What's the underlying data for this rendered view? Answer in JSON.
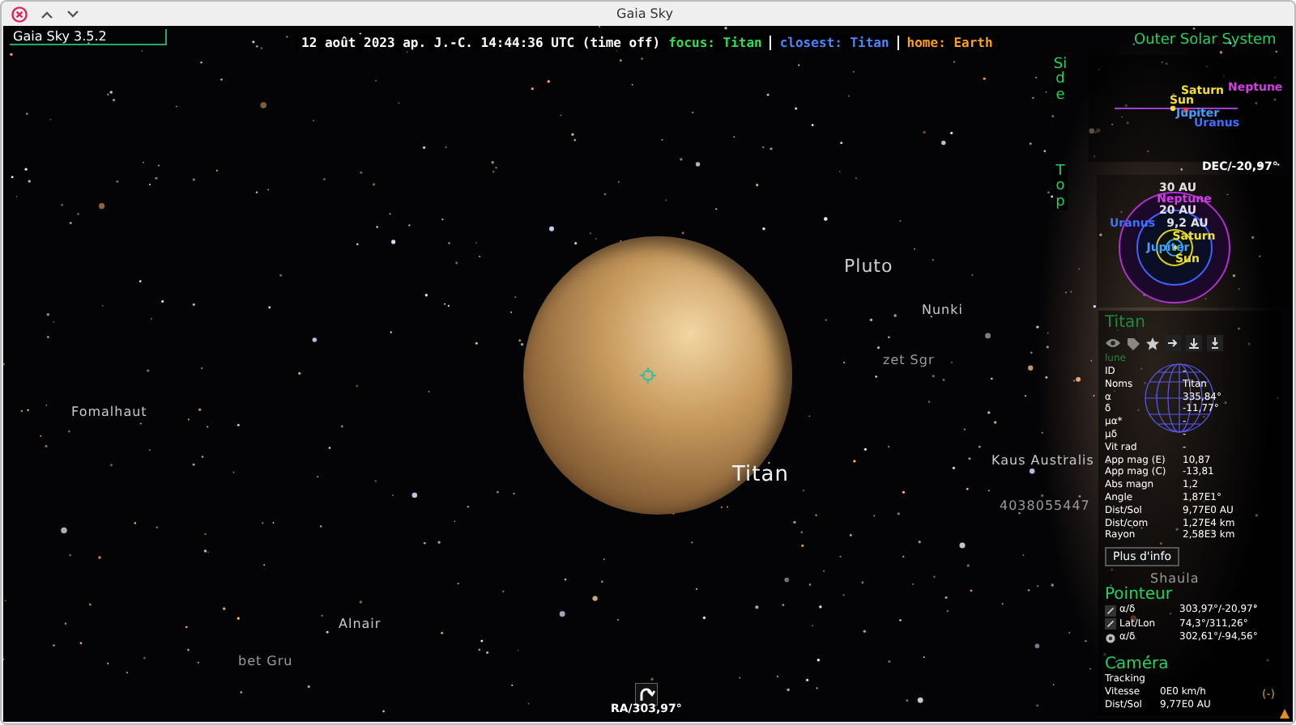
{
  "window": {
    "title": "Gaia Sky"
  },
  "app_version": "Gaia Sky 3.5.2",
  "status": [
    {
      "text": "12 août 2023 ap. J.-C. 14:44:36 UTC (time off)",
      "color": "#ffffff"
    },
    {
      "text": "focus: Titan",
      "color": "#33dd55"
    },
    {
      "text": "closest: Titan",
      "color": "#4a86ff"
    },
    {
      "text": "home: Earth",
      "color": "#ff9f1a"
    }
  ],
  "sky_labels": [
    {
      "text": "Pluto",
      "kind": "planet"
    },
    {
      "text": "Nunki",
      "kind": "star"
    },
    {
      "text": "zet Sgr",
      "kind": "faint"
    },
    {
      "text": "Fomalhaut",
      "kind": "star"
    },
    {
      "text": "Titan",
      "kind": "focus"
    },
    {
      "text": "Kaus Australis",
      "kind": "star"
    },
    {
      "text": "4038055447",
      "kind": "faint"
    },
    {
      "text": "Alnair",
      "kind": "star"
    },
    {
      "text": "bet Gru",
      "kind": "faint"
    },
    {
      "text": "Shaula",
      "kind": "faint"
    }
  ],
  "minimap": {
    "title": "Outer Solar System",
    "side_label": "Side",
    "top_label": "Top",
    "side_bodies": [
      {
        "name": "Saturn",
        "color": "#f0e030"
      },
      {
        "name": "Sun",
        "color": "#f0e030"
      },
      {
        "name": "Neptune",
        "color": "#d040e0"
      },
      {
        "name": "Jupiter",
        "color": "#40a0ff"
      },
      {
        "name": "Uranus",
        "color": "#4070ff"
      }
    ],
    "top_labels": [
      {
        "text": "30 AU",
        "color": "#e0e0e0"
      },
      {
        "text": "Neptune",
        "color": "#d040e0"
      },
      {
        "text": "20 AU",
        "color": "#e0e0e0"
      },
      {
        "text": "Uranus",
        "color": "#4070ff"
      },
      {
        "text": "9,2 AU",
        "color": "#e0e0e0"
      },
      {
        "text": "Saturn",
        "color": "#f0e030"
      },
      {
        "text": "Jupiter",
        "color": "#40a0ff"
      },
      {
        "text": "Sun",
        "color": "#f0e030"
      }
    ]
  },
  "dec": "DEC/-20,97°",
  "ra": "RA/303,97°",
  "focus": {
    "name": "Titan",
    "type": "lune",
    "rows": [
      {
        "key": "ID",
        "value": "-"
      },
      {
        "key": "Noms",
        "value": "Titan"
      },
      {
        "key": "α",
        "value": "335,84°"
      },
      {
        "key": "δ",
        "value": "-11,77°"
      },
      {
        "key": "μα*",
        "value": "-"
      },
      {
        "key": "μδ",
        "value": "-"
      },
      {
        "key": "Vit rad",
        "value": "-"
      },
      {
        "key": "App mag (E)",
        "value": "10,87"
      },
      {
        "key": "App mag (C)",
        "value": "-13,81"
      },
      {
        "key": "Abs magn",
        "value": "1,2"
      },
      {
        "key": "Angle",
        "value": "1,87E1°"
      },
      {
        "key": "Dist/Sol",
        "value": "9,77E0 AU"
      },
      {
        "key": "Dist/com",
        "value": "1,27E4 km"
      },
      {
        "key": "Rayon",
        "value": "2,58E3 km"
      }
    ],
    "more_button": "Plus d'info"
  },
  "pointer": {
    "title": "Pointeur",
    "rows": [
      {
        "key": "α/δ",
        "value": "303,97°/-20,97°"
      },
      {
        "key": "Lat/Lon",
        "value": "74,3°/311,26°"
      },
      {
        "key": "α/δ",
        "value": "302,61°/-94,56°"
      }
    ]
  },
  "camera": {
    "title": "Caméra",
    "mode": "Tracking",
    "rows": [
      {
        "key": "Vitesse",
        "value": "0E0 km/h"
      },
      {
        "key": "Dist/Sol",
        "value": "9,77E0 AU"
      }
    ]
  },
  "collapse": "(-)"
}
